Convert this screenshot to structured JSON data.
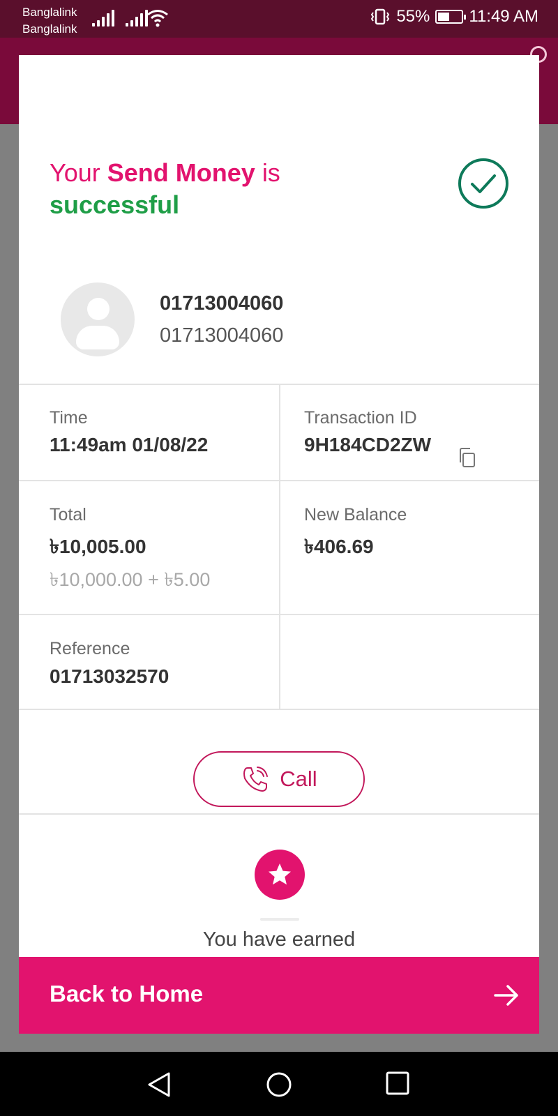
{
  "status_bar": {
    "carrier_1": "Banglalink",
    "carrier_2": "Banglalink",
    "battery": "55%",
    "time": "11:49 AM",
    "battery_level": 0.55
  },
  "result": {
    "title_prefix": "Your",
    "title_action": "Send Money",
    "title_mid": "is",
    "title_status": "successful"
  },
  "recipient": {
    "name": "01713004060",
    "number": "01713004060"
  },
  "details": {
    "time_label": "Time",
    "time_value": "11:49am 01/08/22",
    "txn_label": "Transaction ID",
    "txn_value": "9H184CD2ZW",
    "total_label": "Total",
    "total_value": "৳10,005.00",
    "total_breakdown": "৳10,000.00 + ৳5.00",
    "balance_label": "New Balance",
    "balance_value": "৳406.69",
    "reference_label": "Reference",
    "reference_value": "01713032570"
  },
  "actions": {
    "call_label": "Call",
    "earned_text": "You have earned",
    "home_label": "Back to Home"
  },
  "colors": {
    "brand_pink": "#e2136e",
    "success_green": "#1f9e47",
    "status_bar": "#5a0f2c"
  },
  "icons": [
    "signal-icon",
    "wifi-icon",
    "vibrate-icon",
    "battery-icon",
    "checkmark-circle-icon",
    "avatar-icon",
    "copy-icon",
    "phone-icon",
    "star-icon",
    "arrow-right-icon",
    "back-nav-icon",
    "home-nav-icon",
    "recents-nav-icon"
  ]
}
